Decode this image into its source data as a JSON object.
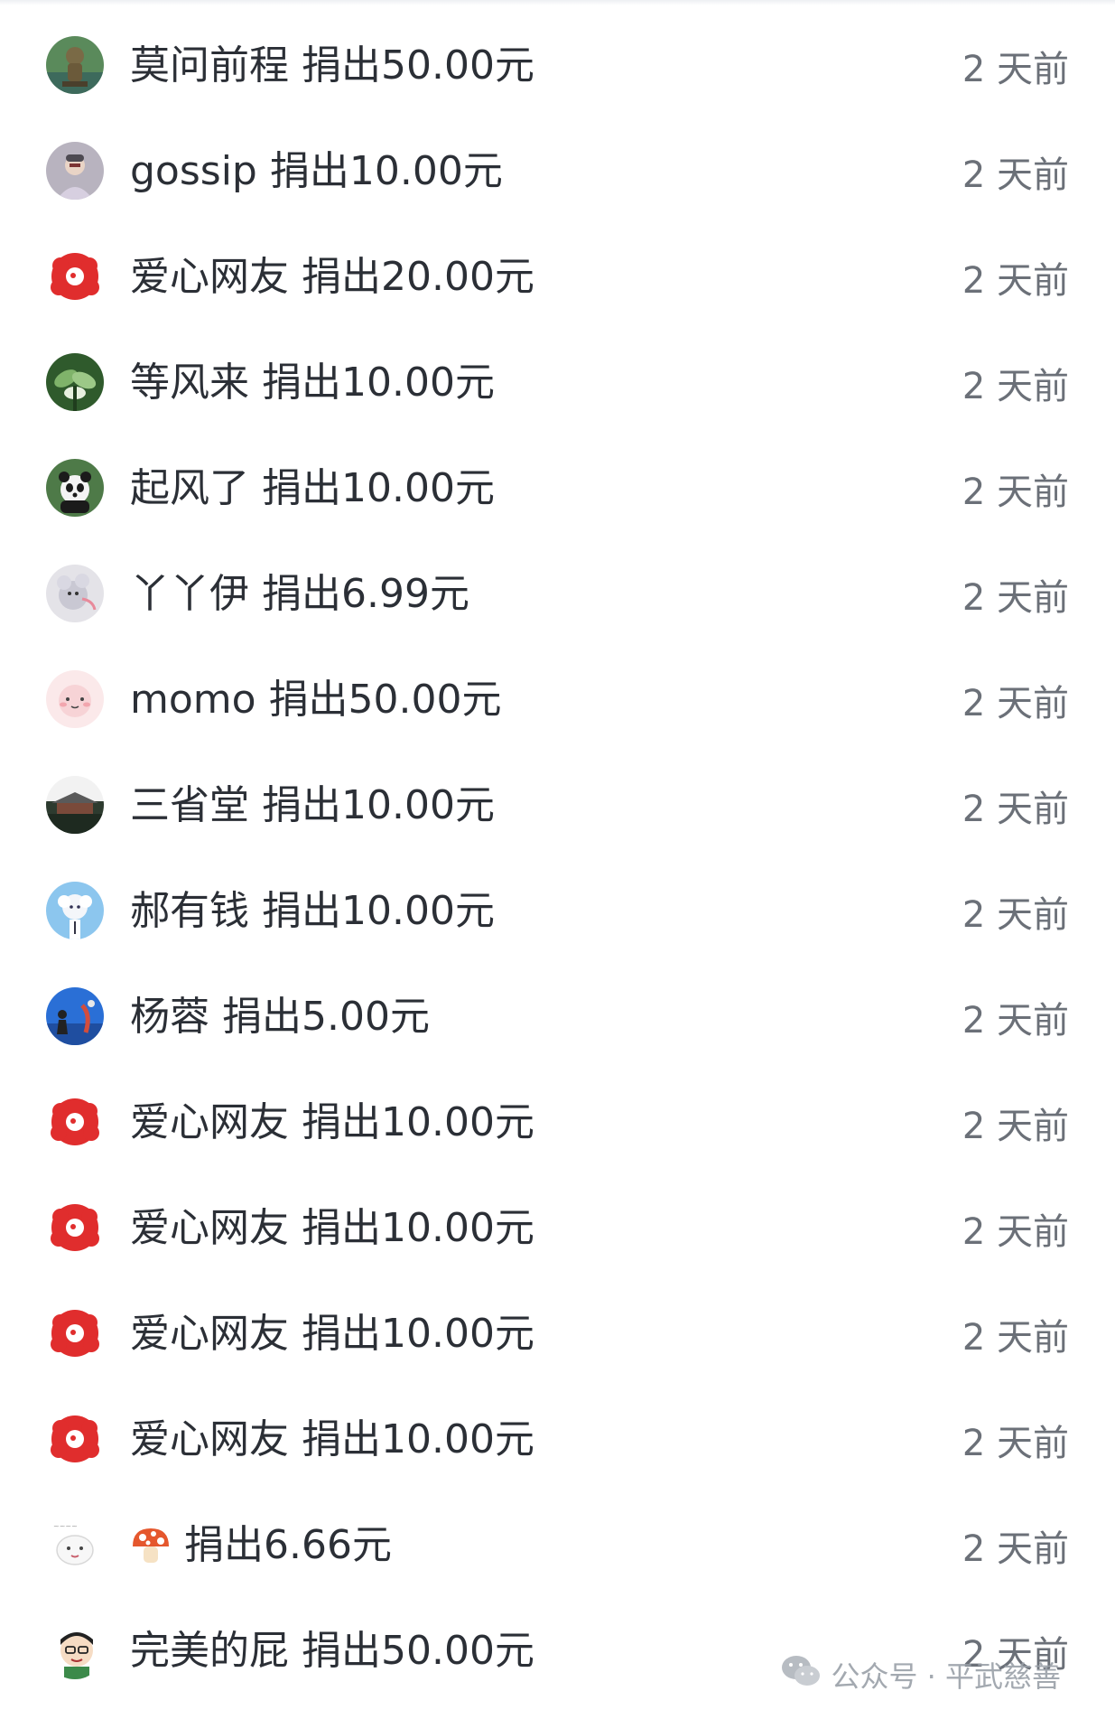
{
  "donations": [
    {
      "name": "莫问前程",
      "amount_text": "捐出50.00元",
      "time": "2 天前",
      "avatar": "avatar-statue"
    },
    {
      "name": "gossip",
      "amount_text": "捐出10.00元",
      "time": "2 天前",
      "avatar": "avatar-person-gray"
    },
    {
      "name": "爱心网友",
      "amount_text": "捐出20.00元",
      "time": "2 天前",
      "avatar": "avatar-red-flower"
    },
    {
      "name": "等风来",
      "amount_text": "捐出10.00元",
      "time": "2 天前",
      "avatar": "avatar-green-leaves"
    },
    {
      "name": "起风了",
      "amount_text": "捐出10.00元",
      "time": "2 天前",
      "avatar": "avatar-panda"
    },
    {
      "name": "丫丫伊",
      "amount_text": "捐出6.99元",
      "time": "2 天前",
      "avatar": "avatar-mouse-cartoon"
    },
    {
      "name": "momo",
      "amount_text": "捐出50.00元",
      "time": "2 天前",
      "avatar": "avatar-pink-cartoon"
    },
    {
      "name": "三省堂",
      "amount_text": "捐出10.00元",
      "time": "2 天前",
      "avatar": "avatar-building"
    },
    {
      "name": "郝有钱",
      "amount_text": "捐出10.00元",
      "time": "2 天前",
      "avatar": "avatar-anime-character"
    },
    {
      "name": "杨蓉",
      "amount_text": "捐出5.00元",
      "time": "2 天前",
      "avatar": "avatar-blue-sky"
    },
    {
      "name": "爱心网友",
      "amount_text": "捐出10.00元",
      "time": "2 天前",
      "avatar": "avatar-red-flower"
    },
    {
      "name": "爱心网友",
      "amount_text": "捐出10.00元",
      "time": "2 天前",
      "avatar": "avatar-red-flower"
    },
    {
      "name": "爱心网友",
      "amount_text": "捐出10.00元",
      "time": "2 天前",
      "avatar": "avatar-red-flower"
    },
    {
      "name": "爱心网友",
      "amount_text": "捐出10.00元",
      "time": "2 天前",
      "avatar": "avatar-red-flower"
    },
    {
      "name": "",
      "name_icon": "mushroom-icon",
      "amount_text": "捐出6.66元",
      "time": "2 天前",
      "avatar": "avatar-white-bear"
    },
    {
      "name": "完美的屁",
      "amount_text": "捐出50.00元",
      "time": "2 天前",
      "avatar": "avatar-boy-glasses"
    }
  ],
  "watermark": {
    "text": "公众号 · 平武慈善",
    "icon": "wechat-icon"
  },
  "colors": {
    "text": "#2b2f36",
    "time": "#6b7078",
    "brand_red": "#e02d2d",
    "watermark": "#9aa0a8"
  }
}
